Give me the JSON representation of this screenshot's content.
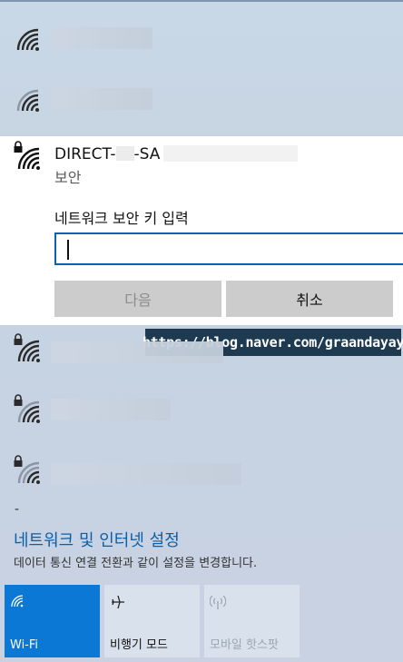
{
  "networks_above": [
    {
      "ssid_hidden": true
    },
    {
      "ssid_hidden": true
    }
  ],
  "expanded_network": {
    "ssid_prefix": "DIRECT-",
    "ssid_suffix": "-SA",
    "security": "보안",
    "key_prompt": "네트워크 보안 키 입력",
    "key_value": "",
    "next_label": "다음",
    "cancel_label": "취소"
  },
  "networks_below": [
    {
      "secured": true,
      "ssid_hidden": true
    },
    {
      "secured": true,
      "ssid_hidden": true
    },
    {
      "secured": true,
      "ssid_hidden": true
    }
  ],
  "watermark": "https://blog.naver.com/graandayay",
  "divider_mark": "-",
  "settings": {
    "link": "네트워크 및 인터넷 설정",
    "description": "데이터 통신 연결 전환과 같이 설정을 변경합니다."
  },
  "quick_actions": [
    {
      "label": "Wi-Fi",
      "active": true,
      "icon": "wifi-icon"
    },
    {
      "label": "비행기 모드",
      "active": false,
      "icon": "airplane-icon"
    },
    {
      "label": "모바일 핫스팟",
      "active": false,
      "disabled": true,
      "icon": "hotspot-icon"
    }
  ],
  "colors": {
    "accent": "#0a78d4",
    "link": "#0b5fa8",
    "focus_border": "#0b63b0"
  }
}
